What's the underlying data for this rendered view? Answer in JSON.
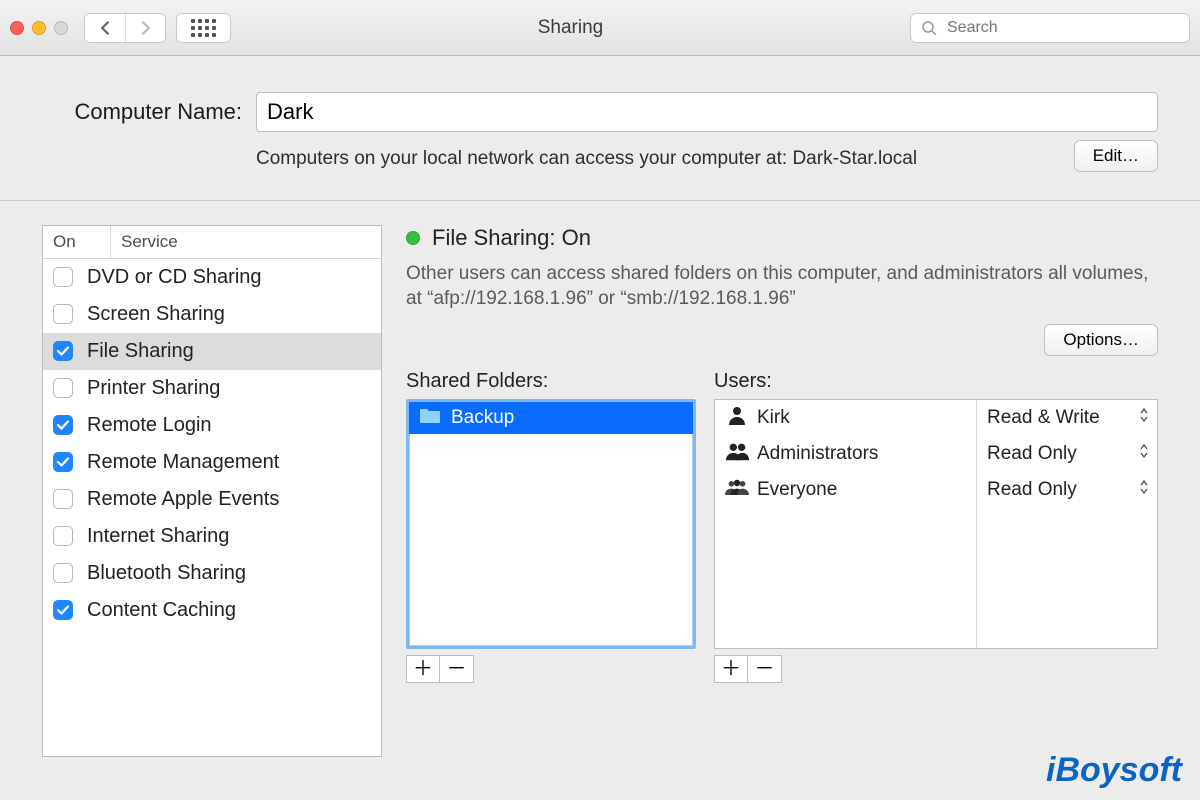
{
  "toolbar": {
    "title": "Sharing",
    "search_placeholder": "Search"
  },
  "computer_name": {
    "label": "Computer Name:",
    "value": "Dark",
    "description": "Computers on your local network can access your computer at: Dark-Star.local",
    "edit_button": "Edit…"
  },
  "services": {
    "header_on": "On",
    "header_service": "Service",
    "items": [
      {
        "label": "DVD or CD Sharing",
        "checked": false,
        "selected": false
      },
      {
        "label": "Screen Sharing",
        "checked": false,
        "selected": false
      },
      {
        "label": "File Sharing",
        "checked": true,
        "selected": true
      },
      {
        "label": "Printer Sharing",
        "checked": false,
        "selected": false
      },
      {
        "label": "Remote Login",
        "checked": true,
        "selected": false
      },
      {
        "label": "Remote Management",
        "checked": true,
        "selected": false
      },
      {
        "label": "Remote Apple Events",
        "checked": false,
        "selected": false
      },
      {
        "label": "Internet Sharing",
        "checked": false,
        "selected": false
      },
      {
        "label": "Bluetooth Sharing",
        "checked": false,
        "selected": false
      },
      {
        "label": "Content Caching",
        "checked": true,
        "selected": false
      }
    ]
  },
  "details": {
    "status_title": "File Sharing: On",
    "status_description": "Other users can access shared folders on this computer, and administrators all volumes, at “afp://192.168.1.96” or “smb://192.168.1.96”",
    "options_button": "Options…",
    "shared_folders_label": "Shared Folders:",
    "users_label": "Users:",
    "shared_folders": [
      {
        "name": "Backup",
        "selected": true
      }
    ],
    "users": [
      {
        "name": "Kirk",
        "icon": "person",
        "permission": "Read & Write"
      },
      {
        "name": "Administrators",
        "icon": "people2",
        "permission": "Read Only"
      },
      {
        "name": "Everyone",
        "icon": "people3",
        "permission": "Read Only"
      }
    ]
  },
  "watermark": "iBoysoft"
}
